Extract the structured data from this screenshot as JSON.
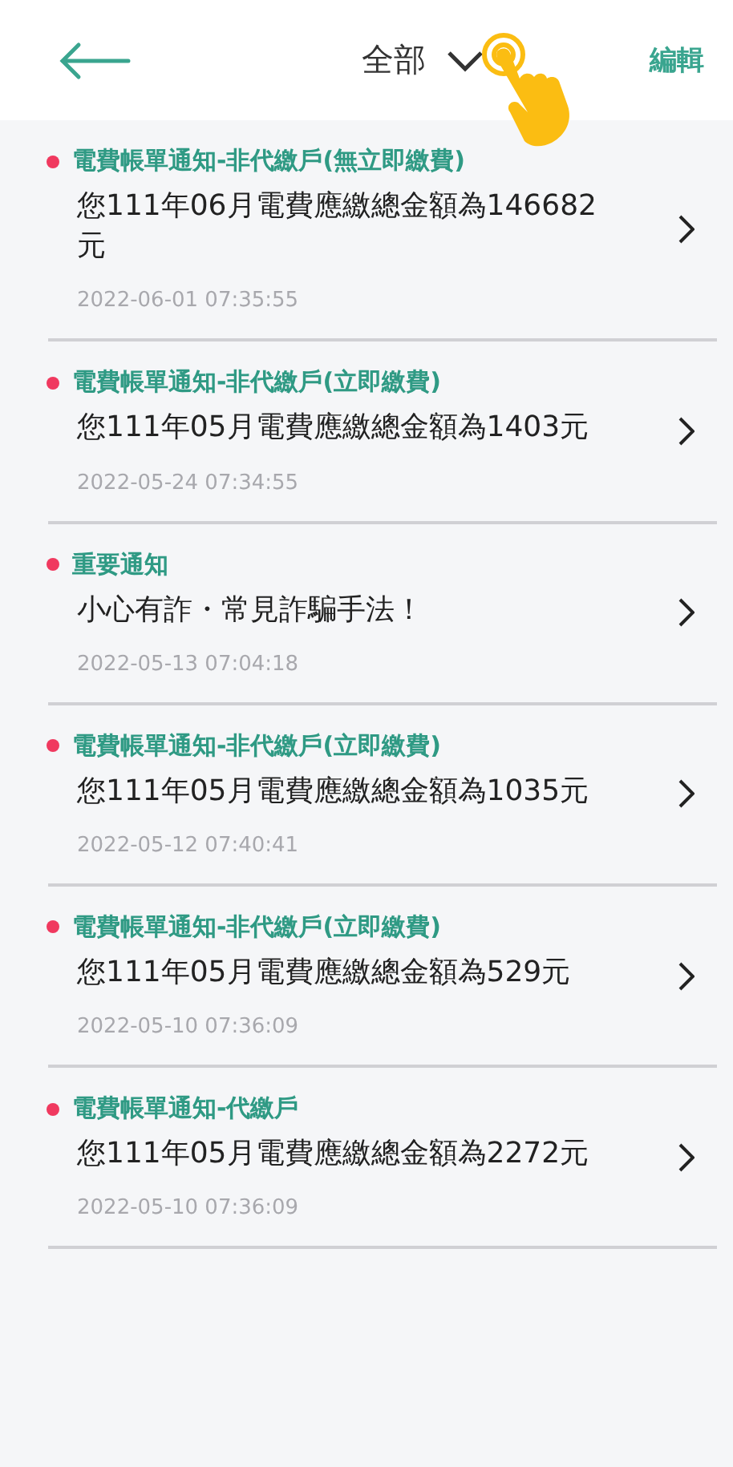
{
  "header": {
    "filter": "全部",
    "edit": "編輯"
  },
  "notifications": [
    {
      "title": "電費帳單通知-非代繳戶(無立即繳費)",
      "body": "您111年06月電費應繳總金額為146682元",
      "time": "2022-06-01 07:35:55",
      "unread": true
    },
    {
      "title": "電費帳單通知-非代繳戶(立即繳費)",
      "body": "您111年05月電費應繳總金額為1403元",
      "time": "2022-05-24 07:34:55",
      "unread": true
    },
    {
      "title": "重要通知",
      "body": "小心有詐・常見詐騙手法！",
      "time": "2022-05-13 07:04:18",
      "unread": true
    },
    {
      "title": "電費帳單通知-非代繳戶(立即繳費)",
      "body": "您111年05月電費應繳總金額為1035元",
      "time": "2022-05-12 07:40:41",
      "unread": true
    },
    {
      "title": "電費帳單通知-非代繳戶(立即繳費)",
      "body": "您111年05月電費應繳總金額為529元",
      "time": "2022-05-10 07:36:09",
      "unread": true
    },
    {
      "title": "電費帳單通知-代繳戶",
      "body": "您111年05月電費應繳總金額為2272元",
      "time": "2022-05-10 07:36:09",
      "unread": true
    }
  ]
}
